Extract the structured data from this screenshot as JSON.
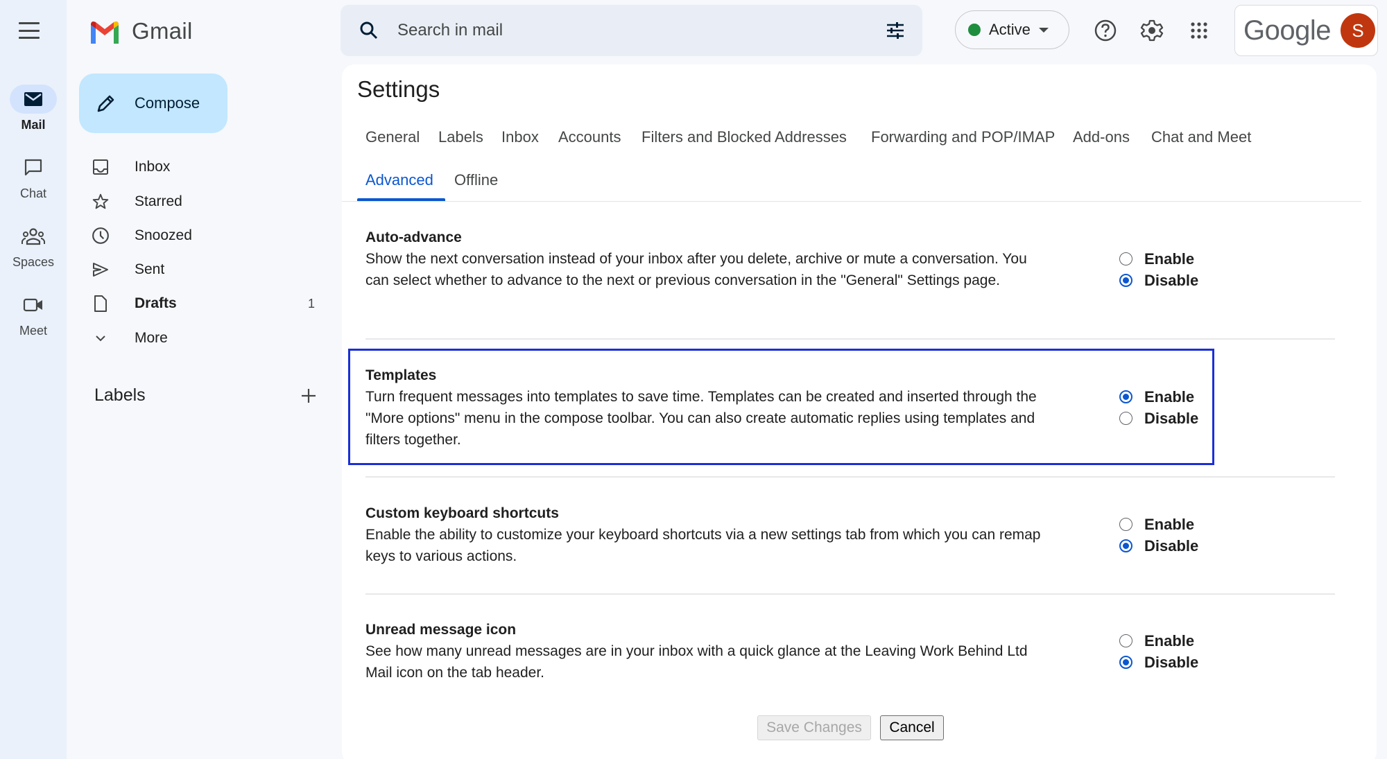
{
  "app": {
    "name": "Gmail"
  },
  "rail": {
    "items": [
      {
        "label": "Mail",
        "icon": "mail-icon",
        "active": true
      },
      {
        "label": "Chat",
        "icon": "chat-icon",
        "active": false
      },
      {
        "label": "Spaces",
        "icon": "spaces-icon",
        "active": false
      },
      {
        "label": "Meet",
        "icon": "meet-icon",
        "active": false
      }
    ]
  },
  "compose": {
    "label": "Compose"
  },
  "nav": {
    "items": [
      {
        "label": "Inbox",
        "icon": "inbox-icon",
        "count": ""
      },
      {
        "label": "Starred",
        "icon": "star-icon",
        "count": ""
      },
      {
        "label": "Snoozed",
        "icon": "clock-icon",
        "count": ""
      },
      {
        "label": "Sent",
        "icon": "send-icon",
        "count": ""
      },
      {
        "label": "Drafts",
        "icon": "draft-icon",
        "count": "1",
        "bold": true
      },
      {
        "label": "More",
        "icon": "chevron-down-icon",
        "count": ""
      }
    ],
    "labels_heading": "Labels"
  },
  "search": {
    "placeholder": "Search in mail",
    "value": ""
  },
  "status": {
    "label": "Active",
    "color": "#1e8e3e"
  },
  "account": {
    "brand": "Google",
    "avatar_initial": "S",
    "avatar_color": "#c0370f"
  },
  "settings": {
    "title": "Settings",
    "tabs_row1": [
      "General",
      "Labels",
      "Inbox",
      "Accounts",
      "Filters and Blocked Addresses",
      "Forwarding and POP/IMAP",
      "Add-ons",
      "Chat and Meet"
    ],
    "tabs_row2": [
      "Advanced",
      "Offline"
    ],
    "active_tab": "Advanced",
    "sections": [
      {
        "title": "Auto-advance",
        "description": "Show the next conversation instead of your inbox after you delete, archive or mute a conversation. You can select whether to advance to the next or previous conversation in the \"General\" Settings page.",
        "options": [
          "Enable",
          "Disable"
        ],
        "selected": "Disable"
      },
      {
        "title": "Templates",
        "description": "Turn frequent messages into templates to save time. Templates can be created and inserted through the \"More options\" menu in the compose toolbar. You can also create automatic replies using templates and filters together.",
        "options": [
          "Enable",
          "Disable"
        ],
        "selected": "Enable",
        "highlighted": true
      },
      {
        "title": "Custom keyboard shortcuts",
        "description": "Enable the ability to customize your keyboard shortcuts via a new settings tab from which you can remap keys to various actions.",
        "options": [
          "Enable",
          "Disable"
        ],
        "selected": "Disable"
      },
      {
        "title": "Unread message icon",
        "description": "See how many unread messages are in your inbox with a quick glance at the Leaving Work Behind Ltd Mail icon on the tab header.",
        "options": [
          "Enable",
          "Disable"
        ],
        "selected": "Disable"
      }
    ],
    "save_label": "Save Changes",
    "cancel_label": "Cancel"
  },
  "colors": {
    "accent": "#0b57d0",
    "highlight_border": "#1a2fd6",
    "compose_bg": "#c2e7ff"
  }
}
